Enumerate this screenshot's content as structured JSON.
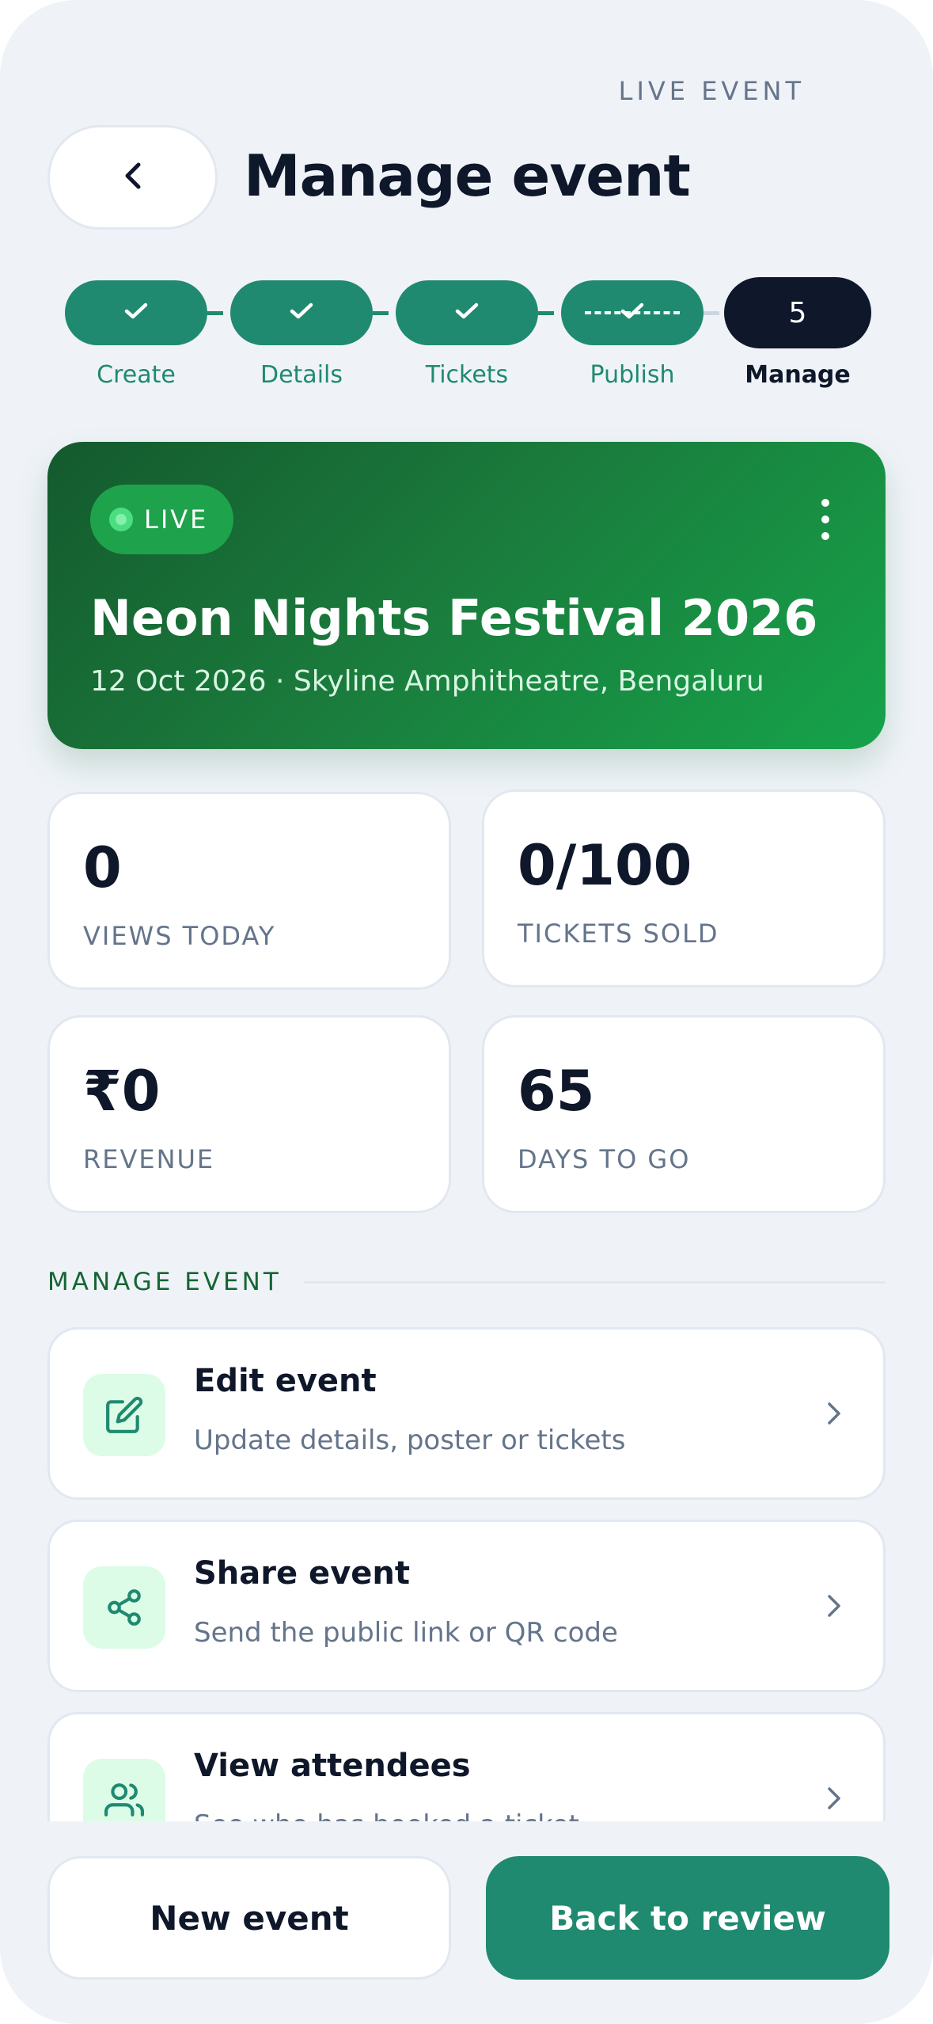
{
  "header": {
    "eyebrow": "LIVE EVENT",
    "title": "Manage event",
    "back_icon": "chevron-left-icon"
  },
  "stepper": {
    "steps": [
      {
        "label": "Create",
        "status": "done"
      },
      {
        "label": "Details",
        "status": "done"
      },
      {
        "label": "Tickets",
        "status": "done"
      },
      {
        "label": "Publish",
        "status": "done"
      },
      {
        "label": "Manage",
        "status": "current",
        "number": "5"
      }
    ],
    "done_color": "#1f8a70",
    "current_color": "#0f172a"
  },
  "hero": {
    "badge": "LIVE",
    "name": "Neon Nights Festival 2026",
    "meta": "12 Oct 2026 · Skyline Amphitheatre, Bengaluru",
    "more_icon": "more-vertical-icon",
    "gradient_colors": [
      "#145a2d",
      "#16a34a"
    ]
  },
  "stats": [
    {
      "value": "0",
      "label": "VIEWS TODAY"
    },
    {
      "value": "0/100",
      "label": "TICKETS SOLD"
    },
    {
      "value": "₹0",
      "label": "REVENUE"
    },
    {
      "value": "65",
      "label": "DAYS TO GO"
    }
  ],
  "manage": {
    "section_title": "MANAGE EVENT",
    "actions": [
      {
        "title": "Edit event",
        "subtitle": "Update details, poster or tickets",
        "icon": "edit-icon"
      },
      {
        "title": "Share event",
        "subtitle": "Send the public link or QR code",
        "icon": "share-icon"
      },
      {
        "title": "View attendees",
        "subtitle": "See who has booked a ticket",
        "icon": "users-icon"
      }
    ]
  },
  "footer": {
    "secondary_label": "New event",
    "primary_label": "Back to review",
    "primary_color": "#1f8a70"
  }
}
